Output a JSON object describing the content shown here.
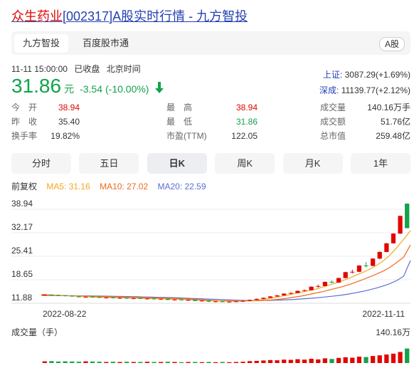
{
  "title": {
    "name": "众生药业",
    "code": "[002317]",
    "rest": "A股实时行情 - 九方智投"
  },
  "tabs": [
    {
      "label": "九方智投",
      "active": true
    },
    {
      "label": "百度股市通",
      "active": false
    }
  ],
  "badge": "A股",
  "status": {
    "time": "11-11 15:00:00",
    "state": "已收盘",
    "tz": "北京时间"
  },
  "quote": {
    "price": "31.86",
    "unit": "元",
    "change": "-3.54",
    "pct": "(-10.00%)"
  },
  "indices": [
    {
      "name": "上证:",
      "value": "3087.29(+1.69%)"
    },
    {
      "name": "深成:",
      "value": "11139.77(+2.12%)"
    }
  ],
  "stats": [
    [
      {
        "label": "今　开",
        "value": "38.94",
        "color": "red"
      },
      {
        "label": "最　高",
        "value": "38.94",
        "color": "red"
      },
      {
        "label": "成交量",
        "value": "140.16万手",
        "color": ""
      }
    ],
    [
      {
        "label": "昨　收",
        "value": "35.40",
        "color": ""
      },
      {
        "label": "最　低",
        "value": "31.86",
        "color": "green"
      },
      {
        "label": "成交额",
        "value": "51.76亿",
        "color": ""
      }
    ],
    [
      {
        "label": "换手率",
        "value": "19.82%",
        "color": ""
      },
      {
        "label": "市盈(TTM)",
        "value": "122.05",
        "color": ""
      },
      {
        "label": "总市值",
        "value": "259.48亿",
        "color": ""
      }
    ]
  ],
  "periods": [
    {
      "label": "分时",
      "active": false
    },
    {
      "label": "五日",
      "active": false
    },
    {
      "label": "日K",
      "active": true
    },
    {
      "label": "周K",
      "active": false
    },
    {
      "label": "月K",
      "active": false
    },
    {
      "label": "1年",
      "active": false
    }
  ],
  "ma": {
    "adj": "前复权",
    "ma5": "MA5: 31.16",
    "ma10": "MA10: 27.02",
    "ma20": "MA20: 22.59",
    "c5": "#f5a623",
    "c10": "#f06a1f",
    "c20": "#5b6fd6"
  },
  "colors": {
    "up": "#e10601",
    "down": "#12a34a"
  },
  "chart_data": {
    "type": "candlestick",
    "yticks": [
      "38.94",
      "32.17",
      "25.41",
      "18.65",
      "11.88"
    ],
    "ylim": [
      11.88,
      38.94
    ],
    "x_start": "2022-08-22",
    "x_end": "2022-11-11",
    "volume_label": "成交量（手）",
    "volume_max": "140.16万",
    "candles": [
      [
        12.6,
        12.8,
        12.4,
        12.7
      ],
      [
        12.7,
        12.8,
        12.5,
        12.6
      ],
      [
        12.6,
        12.7,
        12.3,
        12.5
      ],
      [
        12.5,
        12.6,
        12.2,
        12.4
      ],
      [
        12.4,
        12.5,
        12.1,
        12.2
      ],
      [
        12.2,
        12.3,
        11.9,
        12.0
      ],
      [
        12.0,
        12.2,
        11.8,
        12.1
      ],
      [
        12.1,
        12.3,
        11.9,
        12.0
      ],
      [
        12.0,
        12.1,
        11.7,
        11.8
      ],
      [
        11.8,
        12.0,
        11.6,
        11.9
      ],
      [
        11.9,
        12.0,
        11.6,
        11.7
      ],
      [
        11.7,
        11.9,
        11.5,
        11.8
      ],
      [
        11.8,
        11.9,
        11.5,
        11.6
      ],
      [
        11.6,
        11.8,
        11.4,
        11.7
      ],
      [
        11.7,
        11.8,
        11.4,
        11.5
      ],
      [
        11.5,
        11.7,
        11.3,
        11.6
      ],
      [
        11.6,
        11.7,
        11.3,
        11.4
      ],
      [
        11.4,
        11.6,
        11.2,
        11.5
      ],
      [
        11.5,
        11.6,
        11.1,
        11.2
      ],
      [
        11.2,
        11.4,
        11.0,
        11.3
      ],
      [
        11.3,
        11.4,
        11.0,
        11.1
      ],
      [
        11.1,
        11.3,
        10.9,
        11.2
      ],
      [
        11.2,
        11.3,
        10.8,
        10.9
      ],
      [
        10.9,
        11.1,
        10.7,
        11.0
      ],
      [
        11.0,
        11.1,
        10.6,
        10.7
      ],
      [
        10.7,
        10.9,
        10.5,
        10.8
      ],
      [
        10.8,
        10.9,
        10.5,
        10.6
      ],
      [
        10.6,
        10.8,
        10.4,
        10.7
      ],
      [
        10.7,
        10.9,
        10.5,
        10.8
      ],
      [
        10.8,
        11.0,
        10.6,
        10.9
      ],
      [
        10.9,
        11.3,
        10.8,
        11.2
      ],
      [
        11.2,
        11.6,
        11.1,
        11.5
      ],
      [
        11.5,
        11.9,
        11.4,
        11.8
      ],
      [
        11.8,
        12.3,
        11.7,
        12.2
      ],
      [
        12.2,
        12.6,
        12.1,
        12.5
      ],
      [
        12.5,
        13.1,
        12.4,
        13.0
      ],
      [
        13.0,
        13.4,
        12.8,
        13.2
      ],
      [
        13.2,
        13.9,
        13.1,
        13.8
      ],
      [
        13.8,
        14.2,
        13.6,
        14.0
      ],
      [
        14.0,
        15.1,
        13.9,
        15.0
      ],
      [
        15.0,
        15.6,
        14.7,
        15.2
      ],
      [
        15.2,
        16.5,
        15.1,
        16.4
      ],
      [
        16.4,
        16.8,
        16.0,
        16.2
      ],
      [
        16.2,
        17.6,
        16.1,
        17.5
      ],
      [
        17.5,
        19.3,
        17.4,
        19.2
      ],
      [
        19.2,
        19.9,
        18.8,
        19.3
      ],
      [
        19.3,
        21.2,
        19.2,
        21.1
      ],
      [
        21.1,
        22.1,
        20.6,
        21.0
      ],
      [
        21.0,
        23.2,
        20.9,
        23.1
      ],
      [
        23.1,
        25.2,
        22.9,
        25.0
      ],
      [
        25.0,
        27.6,
        24.9,
        27.5
      ],
      [
        27.5,
        30.4,
        27.4,
        30.3
      ],
      [
        30.3,
        35.4,
        30.2,
        35.4
      ],
      [
        38.94,
        38.94,
        31.86,
        31.86
      ]
    ],
    "ma5": [
      12.8,
      12.7,
      12.6,
      12.5,
      12.4,
      12.3,
      12.2,
      12.1,
      12.0,
      11.95,
      11.9,
      11.85,
      11.8,
      11.75,
      11.7,
      11.65,
      11.6,
      11.55,
      11.5,
      11.45,
      11.4,
      11.3,
      11.2,
      11.1,
      11.0,
      10.95,
      10.9,
      10.85,
      10.8,
      10.82,
      10.9,
      11.0,
      11.2,
      11.5,
      11.8,
      12.2,
      12.6,
      13.0,
      13.4,
      13.8,
      14.2,
      14.8,
      15.4,
      16.0,
      16.7,
      17.4,
      18.3,
      19.1,
      20.0,
      21.1,
      22.4,
      24.1,
      26.3,
      28.6,
      31.16
    ],
    "ma10": [
      12.6,
      12.55,
      12.5,
      12.45,
      12.4,
      12.35,
      12.3,
      12.25,
      12.2,
      12.15,
      12.1,
      12.05,
      12.0,
      11.95,
      11.9,
      11.85,
      11.8,
      11.75,
      11.7,
      11.65,
      11.6,
      11.5,
      11.4,
      11.3,
      11.2,
      11.1,
      11.0,
      10.95,
      10.9,
      10.9,
      10.92,
      10.95,
      11.0,
      11.1,
      11.25,
      11.45,
      11.7,
      12.0,
      12.3,
      12.7,
      13.1,
      13.5,
      14.0,
      14.5,
      15.0,
      15.6,
      16.3,
      17.0,
      17.8,
      18.6,
      19.5,
      20.6,
      22.0,
      23.5,
      27.02
    ],
    "ma20": [
      12.5,
      12.48,
      12.46,
      12.44,
      12.42,
      12.4,
      12.38,
      12.36,
      12.34,
      12.3,
      12.26,
      12.22,
      12.18,
      12.14,
      12.1,
      12.05,
      12.0,
      11.95,
      11.9,
      11.85,
      11.8,
      11.72,
      11.64,
      11.56,
      11.48,
      11.4,
      11.32,
      11.24,
      11.16,
      11.1,
      11.06,
      11.04,
      11.04,
      11.06,
      11.1,
      11.16,
      11.24,
      11.34,
      11.46,
      11.6,
      11.76,
      11.94,
      12.14,
      12.36,
      12.6,
      12.9,
      13.25,
      13.65,
      14.1,
      14.6,
      15.2,
      15.9,
      16.8,
      18.0,
      22.59
    ],
    "volume": [
      8,
      9,
      7,
      8,
      7,
      6,
      8,
      7,
      6,
      5,
      6,
      5,
      6,
      5,
      5,
      6,
      5,
      5,
      6,
      5,
      4,
      5,
      5,
      4,
      5,
      4,
      5,
      4,
      5,
      6,
      9,
      10,
      12,
      14,
      13,
      16,
      15,
      18,
      16,
      20,
      17,
      22,
      19,
      24,
      27,
      25,
      30,
      28,
      33,
      36,
      40,
      44,
      52,
      68,
      100
    ]
  }
}
